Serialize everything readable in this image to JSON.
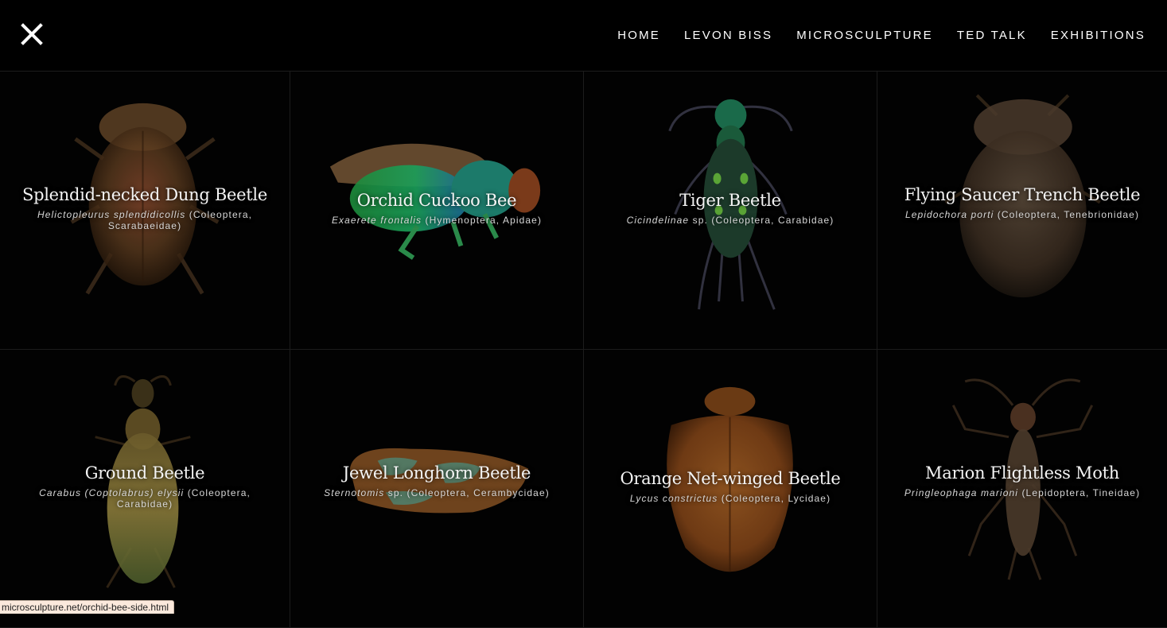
{
  "header": {
    "nav": [
      "HOME",
      "LEVON BISS",
      "MICROSCULPTURE",
      "TED TALK",
      "EXHIBITIONS"
    ]
  },
  "specimens": [
    {
      "title": "Splendid-necked Dung Beetle",
      "genus": "Helictopleurus splendidicollis",
      "suffix": " (Coleoptera, Scarabaeidae)"
    },
    {
      "title": "Orchid Cuckoo Bee",
      "genus": "Exaerete frontalis",
      "suffix": " (Hymenoptera, Apidae)"
    },
    {
      "title": "Tiger Beetle",
      "genus": "Cicindelinae",
      "suffix": " sp. (Coleoptera, Carabidae)"
    },
    {
      "title": "Flying Saucer Trench Beetle",
      "genus": "Lepidochora porti",
      "suffix": " (Coleoptera, Tenebrionidae)"
    },
    {
      "title": "Ground Beetle",
      "genus": "Carabus (Coptolabrus) elysii",
      "suffix": " (Coleoptera, Carabidae)"
    },
    {
      "title": "Jewel Longhorn Beetle",
      "genus": "Sternotomis",
      "suffix": " sp. (Coleoptera, Cerambycidae)"
    },
    {
      "title": "Orange Net-winged Beetle",
      "genus": "Lycus constrictus",
      "suffix": " (Coleoptera, Lycidae)"
    },
    {
      "title": "Marion Flightless Moth",
      "genus": "Pringleophaga marioni",
      "suffix": " (Lepidoptera, Tineidae)"
    }
  ],
  "status_url": "microsculpture.net/orchid-bee-side.html",
  "colors": {
    "background": "#000000",
    "text": "#ffffff",
    "status_bg": "#fbe9dc"
  }
}
